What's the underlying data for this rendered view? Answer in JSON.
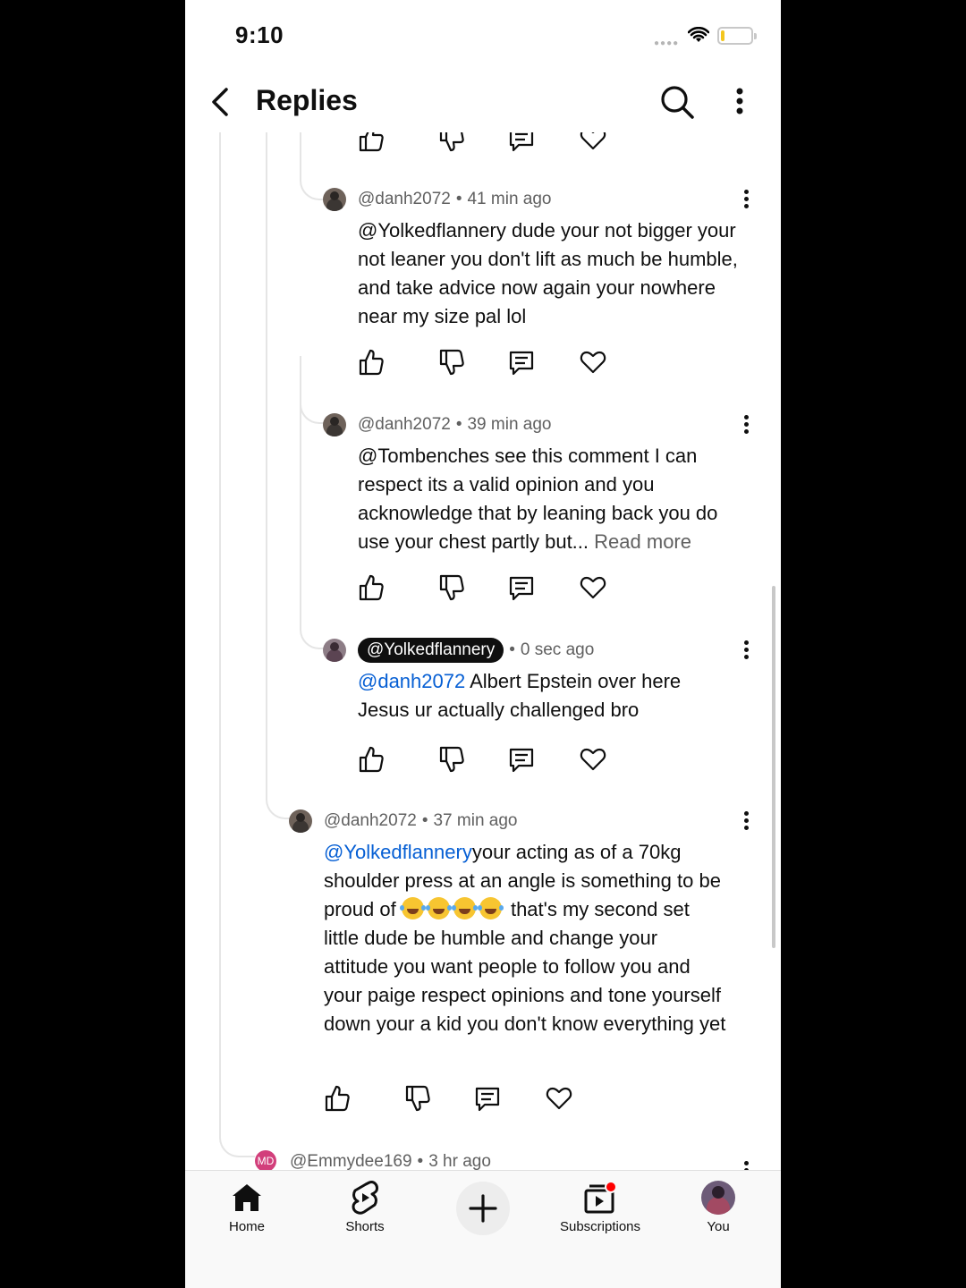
{
  "status_bar": {
    "time": "9:10"
  },
  "header": {
    "title": "Replies"
  },
  "comments": [
    {
      "author": "@danh2072",
      "time": "41 min ago",
      "text": "@Yolkedflannery dude your not bigger your not leaner you don't lift as much be humble, and take advice now again your nowhere near my size pal lol"
    },
    {
      "author": "@danh2072",
      "time": "39 min ago",
      "text": "@Tombenches see this comment I can respect its a valid opinion and you acknowledge that by leaning back you do use your chest partly but...",
      "read_more": "Read more"
    },
    {
      "author": "@Yolkedflannery",
      "time": "0 sec ago",
      "mention": "@danh2072",
      "text": " Albert Epstein over here Jesus ur actually challenged bro"
    },
    {
      "author": "@danh2072",
      "time": "37 min ago",
      "mention": "@Yolkedflannery",
      "text_a": "your acting as of a 70kg shoulder press at an angle is something to be proud of ",
      "text_b": " that's my second set little dude be humble and change your attitude you want people to follow you and your paige respect opinions and tone yourself down your a kid you don't know everything yet"
    },
    {
      "author": "@Emmydee169",
      "time": "3 hr ago",
      "avatar_initials": "MD"
    }
  ],
  "nav": {
    "home": "Home",
    "shorts": "Shorts",
    "subscriptions": "Subscriptions",
    "you": "You"
  },
  "colors": {
    "link": "#065fd4",
    "meta": "#606060",
    "notification_dot": "#ff0000"
  }
}
